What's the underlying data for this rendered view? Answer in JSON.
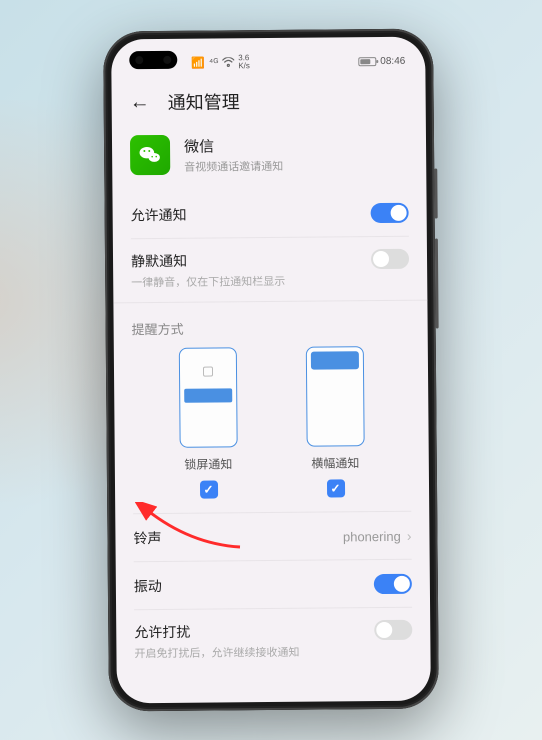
{
  "status_bar": {
    "signal_icon": "⁴ᴳ",
    "wifi_glyph": "◈",
    "speed_top": "3.6",
    "speed_bot": "K/s",
    "battery_glyph": "",
    "time": "08:46"
  },
  "header": {
    "back_glyph": "←",
    "title": "通知管理"
  },
  "app": {
    "name": "微信",
    "subtitle": "音视频通话邀请通知"
  },
  "rows": {
    "allow": {
      "title": "允许通知",
      "on": true
    },
    "silent": {
      "title": "静默通知",
      "sub": "一律静音，仅在下拉通知栏显示",
      "on": false
    },
    "section_label": "提醒方式",
    "modes": {
      "lock": {
        "label": "锁屏通知",
        "checked": true
      },
      "banner": {
        "label": "横幅通知",
        "checked": true
      }
    },
    "ringtone": {
      "title": "铃声",
      "value": "phonering"
    },
    "vibrate": {
      "title": "振动",
      "on": true
    },
    "dnd": {
      "title": "允许打扰",
      "sub": "开启免打扰后，允许继续接收通知",
      "on": false
    }
  }
}
